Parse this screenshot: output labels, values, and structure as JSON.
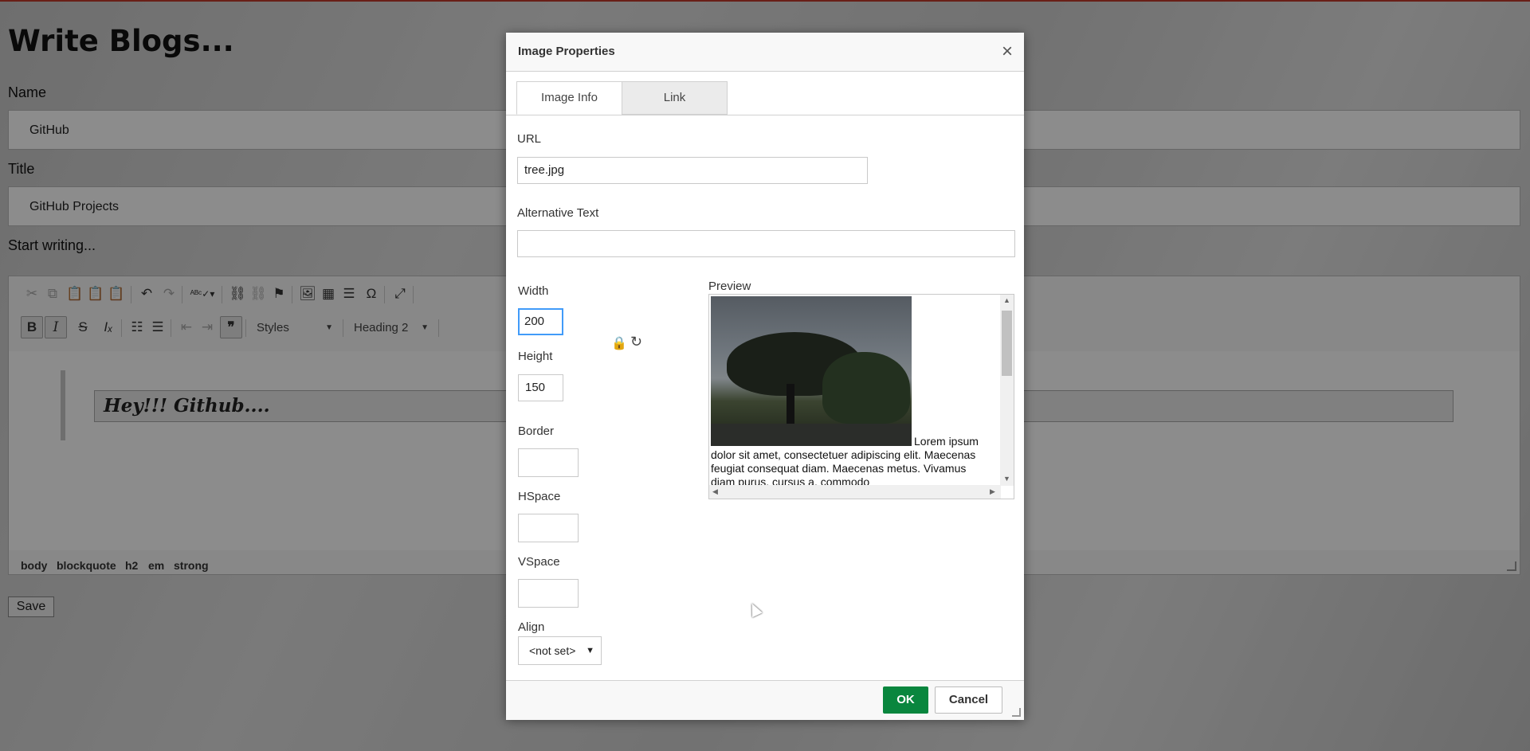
{
  "page": {
    "title": "Write Blogs...",
    "name_label": "Name",
    "name_value": "GitHub",
    "title_label": "Title",
    "title_value": "GitHub Projects",
    "start_label": "Start writing...",
    "save_label": "Save"
  },
  "editor": {
    "styles_combo": "Styles",
    "format_combo": "Heading 2",
    "heading_text": "Hey!!! Github....",
    "path": [
      "body",
      "blockquote",
      "h2",
      "em",
      "strong"
    ]
  },
  "dialog": {
    "title": "Image Properties",
    "close": "×",
    "tabs": [
      "Image Info",
      "Link"
    ],
    "url_label": "URL",
    "url_value": "tree.jpg",
    "alt_label": "Alternative Text",
    "alt_value": "",
    "width_label": "Width",
    "width_value": "200",
    "height_label": "Height",
    "height_value": "150",
    "border_label": "Border",
    "hspace_label": "HSpace",
    "vspace_label": "VSpace",
    "align_label": "Align",
    "align_value": "<not set>",
    "preview_label": "Preview",
    "preview_text_first": "Lorem ipsum",
    "preview_text_rest": "dolor sit amet, consectetuer adipiscing elit. Maecenas feugiat consequat diam. Maecenas metus. Vivamus diam purus, cursus a, commodo",
    "ok_label": "OK",
    "cancel_label": "Cancel"
  },
  "colors": {
    "ok_button": "#09863e",
    "focus_border": "#419bf9",
    "top_accent": "#c0392b"
  }
}
